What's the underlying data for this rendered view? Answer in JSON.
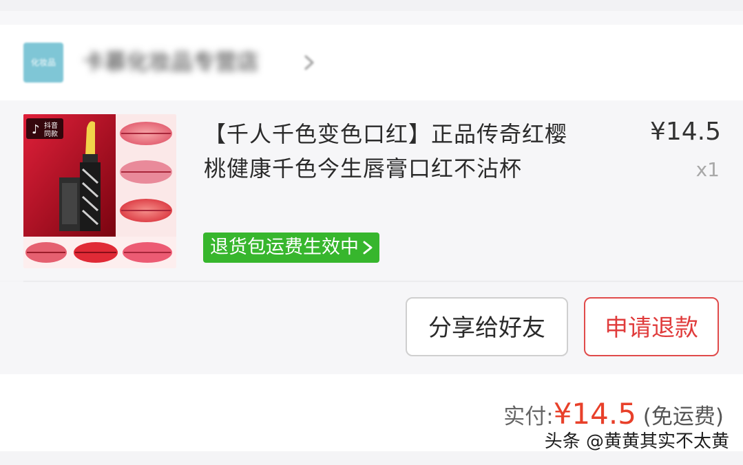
{
  "shop": {
    "logo_text": "化妆品",
    "name": "卡慕化妆品专营店"
  },
  "item": {
    "title_line1": "【千人千色变色口红】正品传奇红樱",
    "title_line2": "桃健康千色今生唇膏口红不沾杯",
    "price": "¥14.5",
    "quantity": "x1",
    "return_badge": "退货包运费生效中",
    "image_tag": "抖音同款"
  },
  "actions": {
    "share_label": "分享给好友",
    "refund_label": "申请退款"
  },
  "summary": {
    "paid_label": "实付:",
    "paid_amount": "¥14.5",
    "shipping_note": "(免运费)"
  },
  "watermark": "头条 @黄黄其实不太黄",
  "colors": {
    "badge_green": "#37b62d",
    "refund_red": "#e03c3c",
    "amount_red": "#e8402a"
  }
}
